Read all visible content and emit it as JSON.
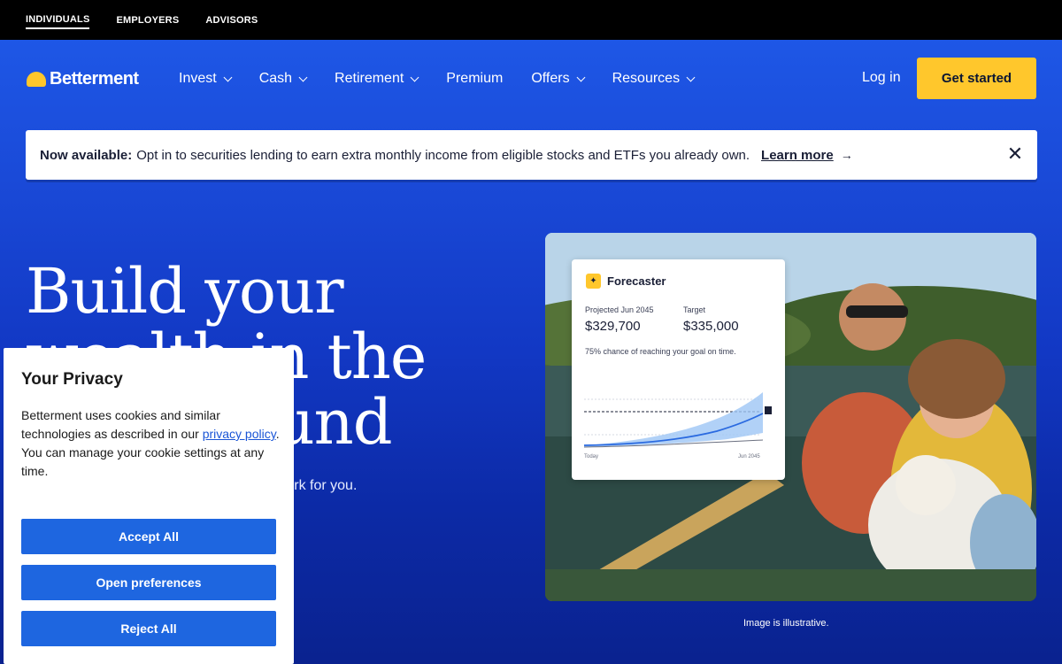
{
  "topbar": {
    "items": [
      {
        "label": "INDIVIDUALS"
      },
      {
        "label": "EMPLOYERS"
      },
      {
        "label": "ADVISORS"
      }
    ]
  },
  "nav": {
    "brand": "Betterment",
    "items": [
      {
        "label": "Invest",
        "has_dropdown": true
      },
      {
        "label": "Cash",
        "has_dropdown": true
      },
      {
        "label": "Retirement",
        "has_dropdown": true
      },
      {
        "label": "Premium",
        "has_dropdown": false
      },
      {
        "label": "Offers",
        "has_dropdown": true
      },
      {
        "label": "Resources",
        "has_dropdown": true
      }
    ],
    "login": "Log in",
    "cta": "Get started"
  },
  "banner": {
    "bold": "Now available:",
    "text": "Opt in to securities lending to earn extra monthly income from eligible stocks and ETFs you already own.",
    "link": "Learn more",
    "arrow_icon": "arrow-right-icon",
    "close_icon": "close-icon"
  },
  "hero": {
    "headline": "Build your wealth in the background",
    "subtext": "Automate for your life. Let our investing work for you.",
    "image_caption": "Image is illustrative."
  },
  "forecaster": {
    "title": "Forecaster",
    "icon": "sparkle-icon",
    "projected_label": "Projected Jun 2045",
    "projected_value": "$329,700",
    "target_label": "Target",
    "target_value": "$335,000",
    "chance_text": "75% chance of reaching your goal on time.",
    "x_start": "Today",
    "x_end": "Jun 2045"
  },
  "privacy": {
    "title": "Your Privacy",
    "body_before": "Betterment uses cookies and similar technologies as described in our",
    "link": "privacy policy",
    "body_after": ". You can manage your cookie settings at any time.",
    "accept": "Accept All",
    "preferences": "Open preferences",
    "reject": "Reject All"
  },
  "colors": {
    "accent": "#ffc72c",
    "hero_blue": "#1a4ad8",
    "button_blue": "#1e66e0"
  }
}
